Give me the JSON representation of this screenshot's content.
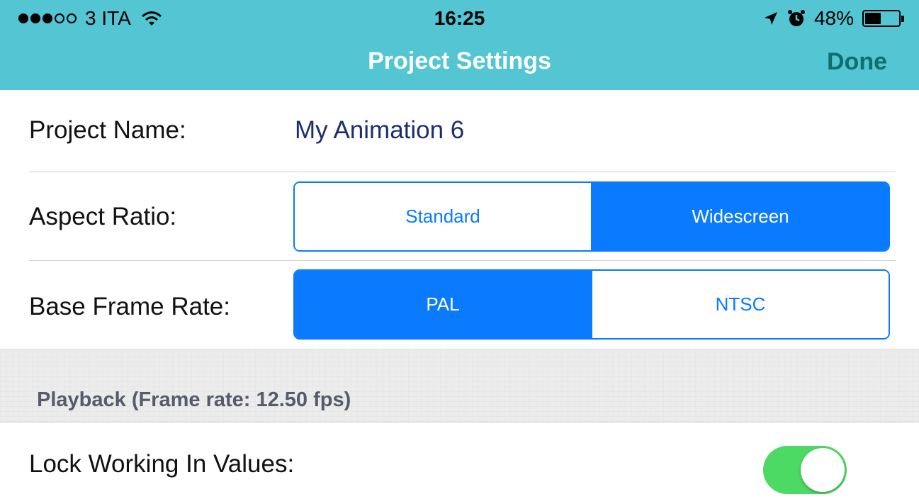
{
  "status_bar": {
    "carrier": "3 ITA",
    "time": "16:25",
    "battery": "48%",
    "battery_level": 0.48,
    "signal_bars_filled": 3,
    "signal_bars_total": 5
  },
  "nav": {
    "title": "Project Settings",
    "done_label": "Done"
  },
  "project_name": {
    "label": "Project Name:",
    "value": "My Animation 6"
  },
  "aspect_ratio": {
    "label": "Aspect Ratio:",
    "options": [
      "Standard",
      "Widescreen"
    ],
    "selected": "Widescreen"
  },
  "frame_rate": {
    "label": "Base Frame Rate:",
    "options": [
      "PAL",
      "NTSC"
    ],
    "selected": "PAL"
  },
  "playback_section": {
    "title": "Playback  (Frame rate: 12.50 fps)"
  },
  "lock_values": {
    "label": "Lock Working In Values:",
    "on": true
  },
  "colors": {
    "nav_bar": "#53c5d3",
    "done": "#0e6f6f",
    "segment_accent": "#0a7aff",
    "toggle_on": "#4cd964"
  }
}
